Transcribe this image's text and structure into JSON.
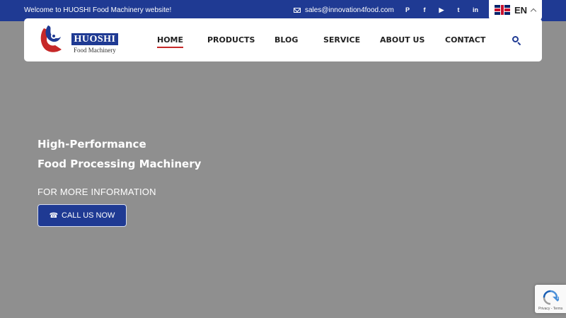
{
  "topbar": {
    "welcome": "Welcome to HUOSHI Food Machinery website!",
    "email": "sales@innovation4food.com",
    "social": [
      {
        "icon": "pinterest-icon",
        "glyph": "P"
      },
      {
        "icon": "facebook-icon",
        "glyph": "f"
      },
      {
        "icon": "youtube-icon",
        "glyph": "▶"
      },
      {
        "icon": "twitter-icon",
        "glyph": "t"
      },
      {
        "icon": "linkedin-icon",
        "glyph": "in"
      }
    ],
    "language": "EN"
  },
  "logo": {
    "brand": "HUOSHI",
    "subtitle": "Food Machinery"
  },
  "nav": {
    "items": [
      "HOME",
      "PRODUCTS",
      "BLOG",
      "SERVICE",
      "ABOUT US",
      "CONTACT"
    ],
    "active": "HOME"
  },
  "hero": {
    "line1": "High-Performance",
    "line2": "Food Processing Machinery",
    "more_info": "FOR MORE INFORMATION",
    "cta": "CALL US NOW"
  },
  "recaptcha": {
    "text": "Privacy - Terms"
  },
  "colors": {
    "brand_blue": "#1f3a93",
    "accent_red": "#c62828",
    "hero_overlay": "#8f8f8f"
  }
}
